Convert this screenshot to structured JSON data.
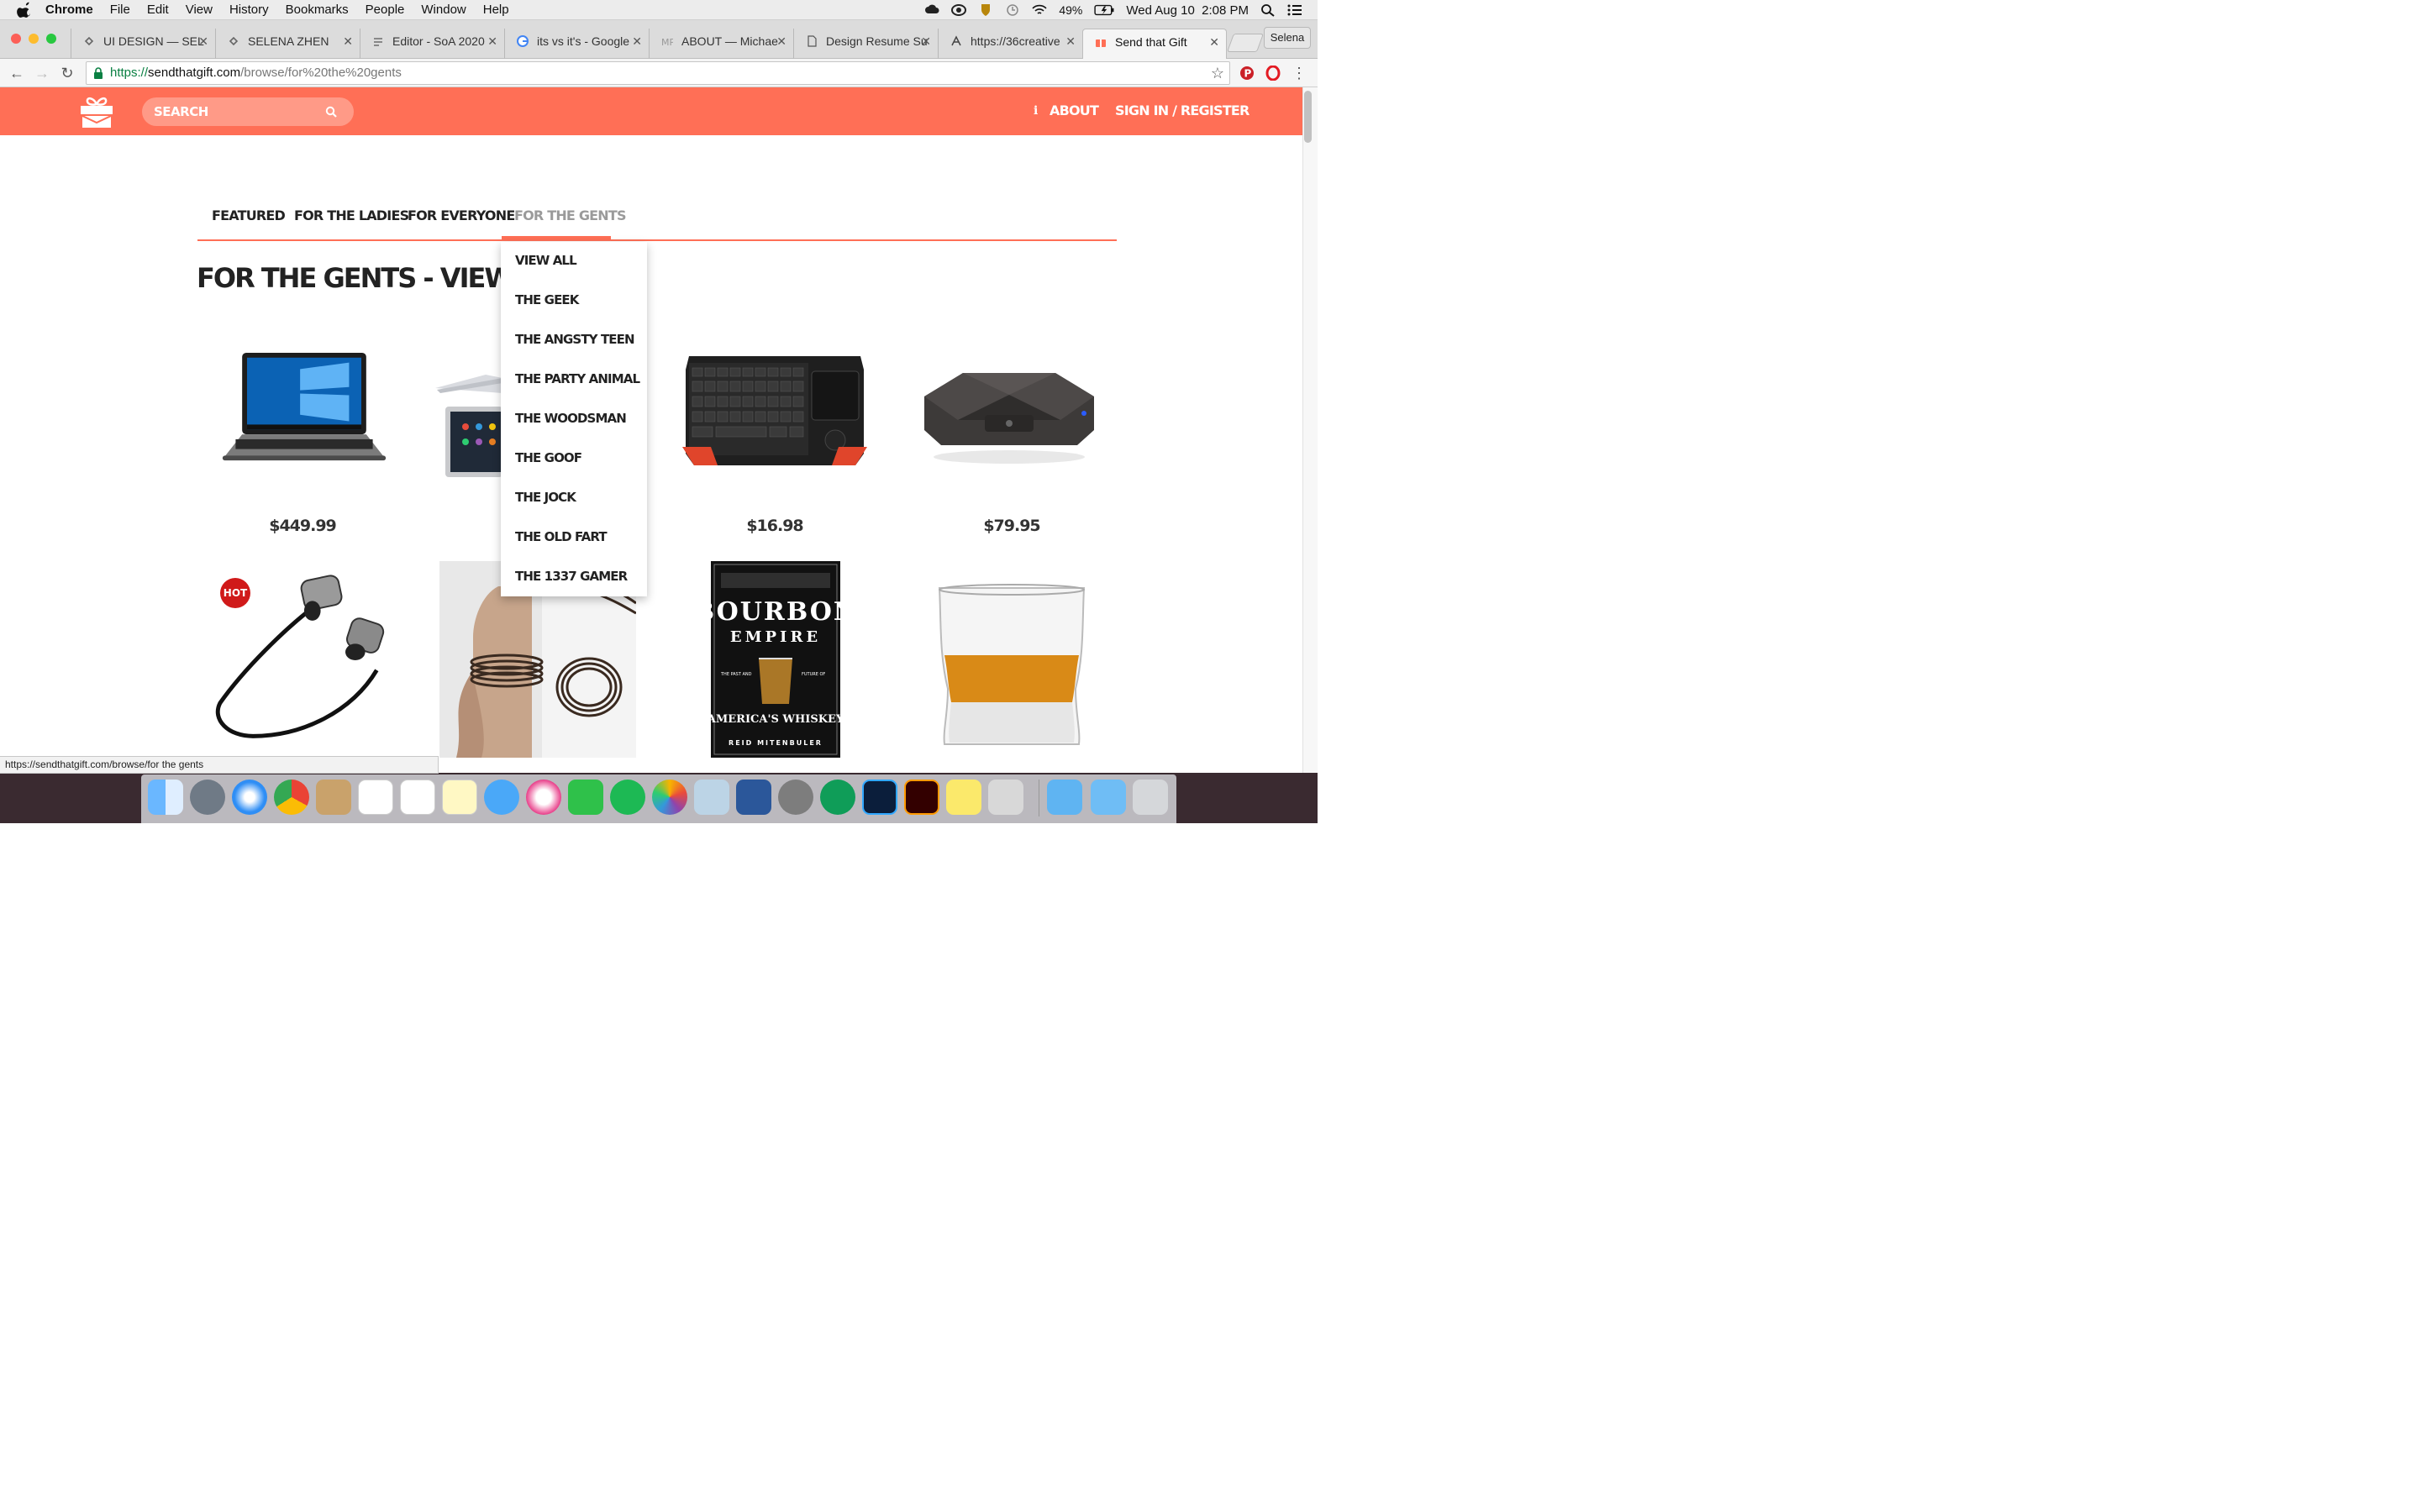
{
  "menubar": {
    "app": "Chrome",
    "items": [
      "File",
      "Edit",
      "View",
      "History",
      "Bookmarks",
      "People",
      "Window",
      "Help"
    ],
    "battery": "49%",
    "datetime": "Wed Aug 10  2:08 PM"
  },
  "tabs": [
    {
      "title": "UI DESIGN — SEL",
      "icon": "squarespace-icon"
    },
    {
      "title": "SELENA ZHEN",
      "icon": "squarespace-icon"
    },
    {
      "title": "Editor - SoA 2020",
      "icon": "editor-icon"
    },
    {
      "title": "its vs it's - Google",
      "icon": "google-icon"
    },
    {
      "title": "ABOUT — Michae",
      "icon": "mp-icon"
    },
    {
      "title": "Design Resume Su",
      "icon": "document-icon"
    },
    {
      "title": "https://36creative",
      "icon": "creative-icon"
    },
    {
      "title": "Send that Gift",
      "icon": "gift-icon",
      "active": true
    }
  ],
  "profile_name": "Selena",
  "address": {
    "scheme": "https://",
    "host": "sendthatgift.com",
    "path": "/browse/for%20the%20gents"
  },
  "site_header": {
    "search_placeholder": "SEARCH",
    "about": "ABOUT",
    "signin": "SIGN IN / REGISTER"
  },
  "categories": [
    {
      "label": "FEATURED",
      "active": false
    },
    {
      "label": "FOR THE LADIES",
      "active": false
    },
    {
      "label": "FOR EVERYONE",
      "active": false
    },
    {
      "label": "FOR THE GENTS",
      "active": true
    }
  ],
  "page_title": "FOR THE GENTS - VIEW_ALL",
  "dropdown_items": [
    "VIEW ALL",
    "THE GEEK",
    "THE ANGSTY TEEN",
    "THE PARTY ANIMAL",
    "THE WOODSMAN",
    "THE GOOF",
    "THE JOCK",
    "THE OLD FART",
    "THE 1337 GAMER"
  ],
  "products_row1": [
    {
      "name": "laptop",
      "price": "$449.99"
    },
    {
      "name": "convertible-laptop",
      "price": ""
    },
    {
      "name": "mini-keyboard",
      "price": "$16.98"
    },
    {
      "name": "speaker",
      "price": "$79.95"
    }
  ],
  "products_row2": [
    {
      "name": "bluetooth-earbuds",
      "badge": "HOT"
    },
    {
      "name": "leather-bracelets"
    },
    {
      "name": "bourbon-empire-book",
      "book_title_top": "BOURBON",
      "book_title_mid": "EMPIRE",
      "book_subtitle_left": "THE PAST AND",
      "book_subtitle_right": "FUTURE OF",
      "book_title_bottom": "AMERICA'S WHISKEY",
      "book_author": "REID MITENBULER"
    },
    {
      "name": "whiskey-glass"
    }
  ],
  "status_url": "https://sendthatgift.com/browse/for the gents",
  "colors": {
    "brand": "#ff6f56",
    "search_bg": "#ff9a87",
    "hot": "#d01a1a"
  }
}
